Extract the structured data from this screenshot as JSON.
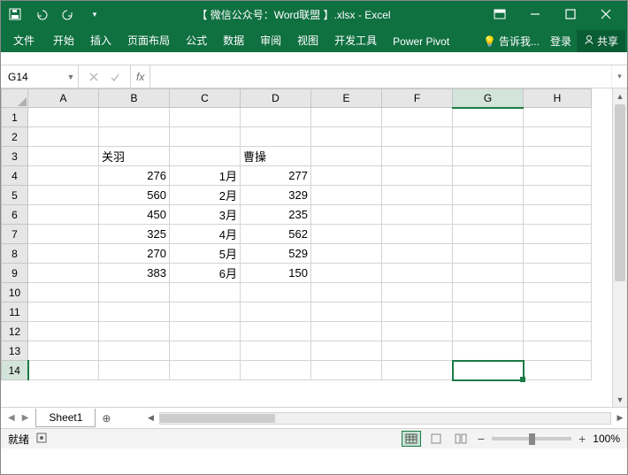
{
  "title": "【 微信公众号：Word联盟 】.xlsx - Excel",
  "chart_data": {
    "type": "table",
    "headers": [
      "关羽",
      "",
      "曹操"
    ],
    "rows": [
      [
        276,
        "1月",
        277
      ],
      [
        560,
        "2月",
        329
      ],
      [
        450,
        "3月",
        235
      ],
      [
        325,
        "4月",
        562
      ],
      [
        270,
        "5月",
        529
      ],
      [
        383,
        "6月",
        150
      ]
    ]
  },
  "ribbon": {
    "file": "文件",
    "home": "开始",
    "insert": "插入",
    "layout": "页面布局",
    "formulas": "公式",
    "data": "数据",
    "review": "审阅",
    "view": "视图",
    "developer": "开发工具",
    "powerpivot": "Power Pivot",
    "tellme": "告诉我...",
    "signin": "登录",
    "share": "共享"
  },
  "namebox": "G14",
  "formula": "",
  "columns": [
    "A",
    "B",
    "C",
    "D",
    "E",
    "F",
    "G",
    "H"
  ],
  "rows_n": [
    "1",
    "2",
    "3",
    "4",
    "5",
    "6",
    "7",
    "8",
    "9",
    "10",
    "11",
    "12",
    "13",
    "14"
  ],
  "cells": {
    "B3": "关羽",
    "D3": "曹操",
    "B4": "276",
    "C4": "1月",
    "D4": "277",
    "B5": "560",
    "C5": "2月",
    "D5": "329",
    "B6": "450",
    "C6": "3月",
    "D6": "235",
    "B7": "325",
    "C7": "4月",
    "D7": "562",
    "B8": "270",
    "C8": "5月",
    "D8": "529",
    "B9": "383",
    "C9": "6月",
    "D9": "150"
  },
  "sheet": "Sheet1",
  "status": "就绪",
  "zoom": "100%"
}
